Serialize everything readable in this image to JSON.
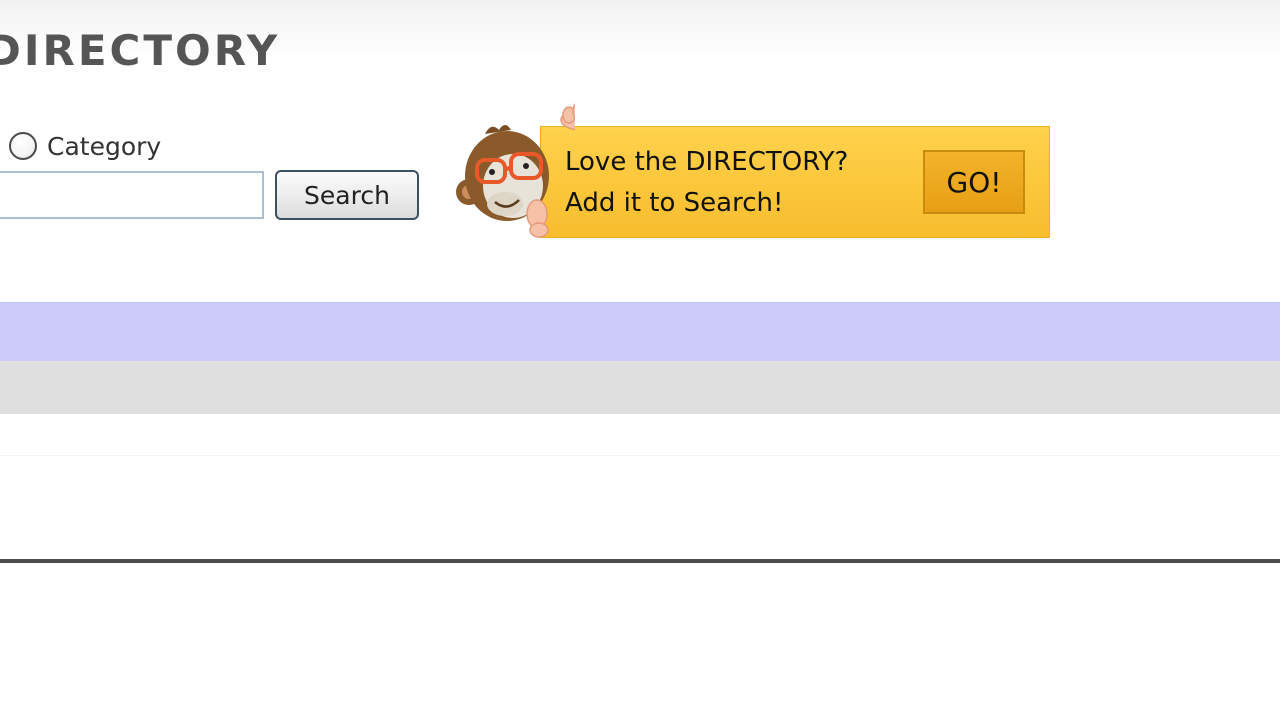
{
  "header": {
    "title": "DIRECTORY"
  },
  "search": {
    "radio_label": "Category",
    "input_value": "",
    "button_label": "Search"
  },
  "promo": {
    "line1": "Love the DIRECTORY?",
    "line2": "Add it to Search!",
    "go_label": "GO!",
    "mascot_icon": "monkey-mascot-icon"
  },
  "colors": {
    "promo_background": "#fbc63a",
    "go_button": "#e7a015",
    "purple_band": "#cccbf9",
    "gray_band": "#dfdfdf",
    "title_text": "#555555"
  }
}
